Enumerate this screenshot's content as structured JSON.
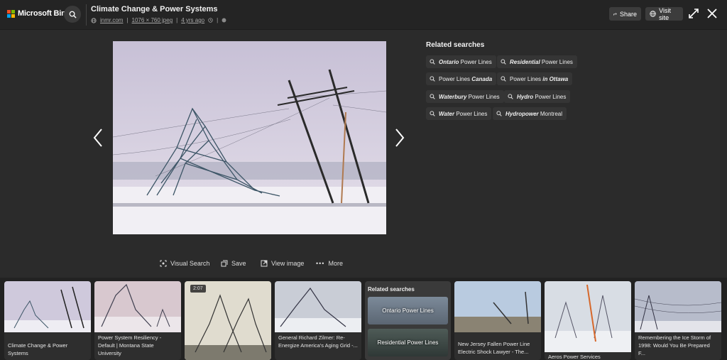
{
  "header": {
    "brand": "Microsoft Bing",
    "title": "Climate Change & Power Systems",
    "source": "inmr.com",
    "dimensions": "1076 × 760 jpeg",
    "age": "4 yrs ago",
    "share_label": "Share",
    "visit_label": "Visit site"
  },
  "related": {
    "title": "Related searches",
    "chips": [
      {
        "bold": "Ontario",
        "rest": " Power Lines"
      },
      {
        "bold": "Residential",
        "rest": " Power Lines"
      },
      {
        "pre": "Power Lines ",
        "bold": "Canada"
      },
      {
        "pre": "Power Lines ",
        "bold": "in Ottawa"
      },
      {
        "bold": "Waterbury",
        "rest": " Power Lines"
      },
      {
        "bold": "Hydro",
        "rest": " Power Lines"
      },
      {
        "bold": "Water",
        "rest": " Power Lines"
      },
      {
        "bold": "Hydropower",
        "rest": " Montreal"
      }
    ]
  },
  "actions": {
    "visual_search": "Visual Search",
    "save": "Save",
    "view_image": "View image",
    "more": "More"
  },
  "strip": {
    "tile1_caption": "Climate Change & Power Systems",
    "tile2_caption": "Power System Resiliency - Default | Montana State University",
    "tile3_duration": "2:07",
    "tile4_caption": "General Richard Zilmer: Re-Energize America's Aging Grid -...",
    "related_title": "Related searches",
    "related_1": "Ontario Power Lines",
    "related_2": "Residential Power Lines",
    "tile6_caption": "New Jersey Fallen Power Line Electric Shock Lawyer - The...",
    "tile7_caption": "Aeros Power Services",
    "tile8_caption": "Remembering the Ice Storm of 1998: Would You Be Prepared F..."
  },
  "colors": {
    "accent_red": "#f25022",
    "accent_green": "#7fba00",
    "accent_blue": "#00a4ef",
    "accent_yellow": "#ffb900"
  }
}
